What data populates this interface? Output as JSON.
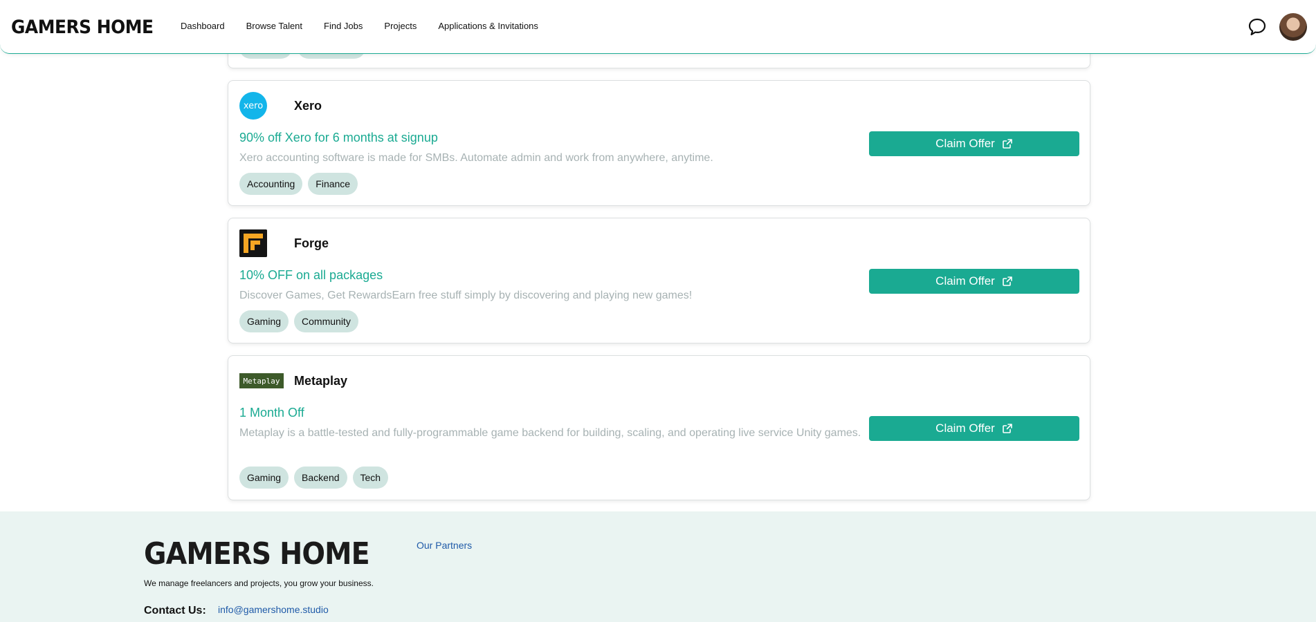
{
  "header": {
    "logo": "GAMERS HOME",
    "nav": [
      "Dashboard",
      "Browse Talent",
      "Find Jobs",
      "Projects",
      "Applications & Invitations"
    ],
    "icons": {
      "messages": "chat-bubble-icon",
      "profile": "user-avatar"
    }
  },
  "offers": [
    {
      "name": "Xero",
      "logo_text": "xero",
      "title": "90% off Xero for 6 months at signup",
      "description": "Xero accounting software is made for SMBs. Automate admin and work from anywhere, anytime.",
      "tags": [
        "Accounting",
        "Finance"
      ],
      "button": "Claim Offer"
    },
    {
      "name": "Forge",
      "title": "10% OFF on all packages",
      "description": "Discover Games, Get RewardsEarn free stuff simply by discovering and playing new games!",
      "tags": [
        "Gaming",
        "Community"
      ],
      "button": "Claim Offer"
    },
    {
      "name": "Metaplay",
      "logo_text": "Metaplay",
      "title": "1 Month Off",
      "description": "Metaplay is a battle-tested and fully-programmable game backend for building, scaling, and operating live service Unity games.",
      "tags": [
        "Gaming",
        "Backend",
        "Tech"
      ],
      "button": "Claim Offer"
    }
  ],
  "footer": {
    "logo": "GAMERS HOME",
    "tagline": "We manage freelancers and projects, you grow your business.",
    "contact_label": "Contact Us:",
    "email": "info@gamershome.studio",
    "partners_link": "Our Partners"
  },
  "colors": {
    "accent": "#1aaa92",
    "tag_bg": "#cfe4e0",
    "footer_bg": "#eaf4f2",
    "link": "#1f5aa8"
  }
}
